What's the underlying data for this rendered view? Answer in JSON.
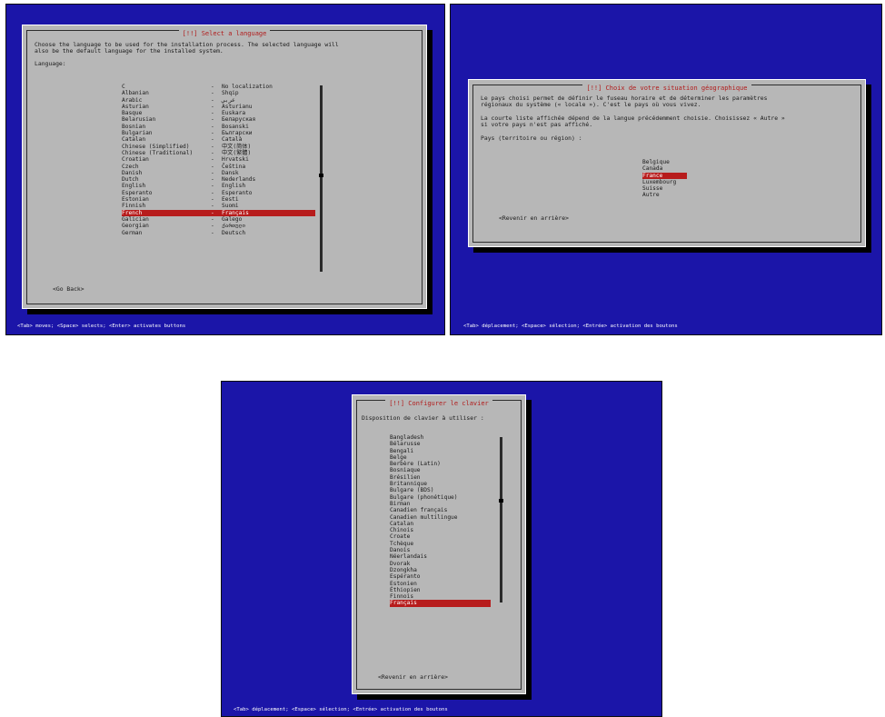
{
  "screen_language": {
    "title": "[!!] Select a language",
    "intro_line1": "Choose the language to be used for the installation process. The selected language will",
    "intro_line2": "also be the default language for the installed system.",
    "prompt": "Language:",
    "languages": [
      {
        "name": "C",
        "native": "No localization"
      },
      {
        "name": "Albanian",
        "native": "Shqip"
      },
      {
        "name": "Arabic",
        "native": "عربي"
      },
      {
        "name": "Asturian",
        "native": "Asturianu"
      },
      {
        "name": "Basque",
        "native": "Euskara"
      },
      {
        "name": "Belarusian",
        "native": "Беларуская"
      },
      {
        "name": "Bosnian",
        "native": "Bosanski"
      },
      {
        "name": "Bulgarian",
        "native": "Български"
      },
      {
        "name": "Catalan",
        "native": "Català"
      },
      {
        "name": "Chinese (Simplified)",
        "native": "中文(简体)"
      },
      {
        "name": "Chinese (Traditional)",
        "native": "中文(繁體)"
      },
      {
        "name": "Croatian",
        "native": "Hrvatski"
      },
      {
        "name": "Czech",
        "native": "Čeština"
      },
      {
        "name": "Danish",
        "native": "Dansk"
      },
      {
        "name": "Dutch",
        "native": "Nederlands"
      },
      {
        "name": "English",
        "native": "English"
      },
      {
        "name": "Esperanto",
        "native": "Esperanto"
      },
      {
        "name": "Estonian",
        "native": "Eesti"
      },
      {
        "name": "Finnish",
        "native": "Suomi"
      },
      {
        "name": "French",
        "native": "Français"
      },
      {
        "name": "Galician",
        "native": "Galego"
      },
      {
        "name": "Georgian",
        "native": "ქართული"
      },
      {
        "name": "German",
        "native": "Deutsch"
      }
    ],
    "selected_index": 19,
    "separator": "-",
    "back_button": "<Go Back>",
    "status_bar": "<Tab> moves; <Space> selects; <Enter> activates buttons"
  },
  "screen_location": {
    "title": "[!!] Choix de votre situation géographique",
    "para1_line1": "Le pays choisi permet de définir le fuseau horaire et de déterminer les paramètres",
    "para1_line2": "régionaux du système (« locale »). C'est le pays où vous vivez.",
    "para2_line1": "La courte liste affichée dépend de la langue précédemment choisie. Choisissez « Autre »",
    "para2_line2": "si votre pays n'est pas affiché.",
    "prompt": "Pays (territoire ou région) :",
    "countries": [
      "Belgique",
      "Canada",
      "France",
      "Luxembourg",
      "Suisse",
      "Autre"
    ],
    "selected_index": 2,
    "back_button": "<Revenir en arrière>",
    "status_bar": "<Tab> déplacement; <Espace> sélection; <Entrée> activation des boutons"
  },
  "screen_keyboard": {
    "title": "[!!] Configurer le clavier",
    "prompt": "Disposition de clavier à utiliser :",
    "layouts": [
      "Bangladesh",
      "Bélarusse",
      "Bengali",
      "Belge",
      "Berbère (Latin)",
      "Bosniaque",
      "Brésilien",
      "Britannique",
      "Bulgare (BDS)",
      "Bulgare (phonétique)",
      "Birman",
      "Canadien français",
      "Canadien multilingue",
      "Catalan",
      "Chinois",
      "Croate",
      "Tchèque",
      "Danois",
      "Néerlandais",
      "Dvorak",
      "Dzongkha",
      "Espéranto",
      "Estonien",
      "Éthiopien",
      "Finnois",
      "Français"
    ],
    "selected_index": 25,
    "back_button": "<Revenir en arrière>",
    "status_bar": "<Tab> déplacement; <Espace> sélection; <Entrée> activation des boutons"
  },
  "colors": {
    "background": "#1b15a8",
    "dialog": "#b7b7b7",
    "title": "#b11b1b",
    "selection": "#b71c1c"
  }
}
